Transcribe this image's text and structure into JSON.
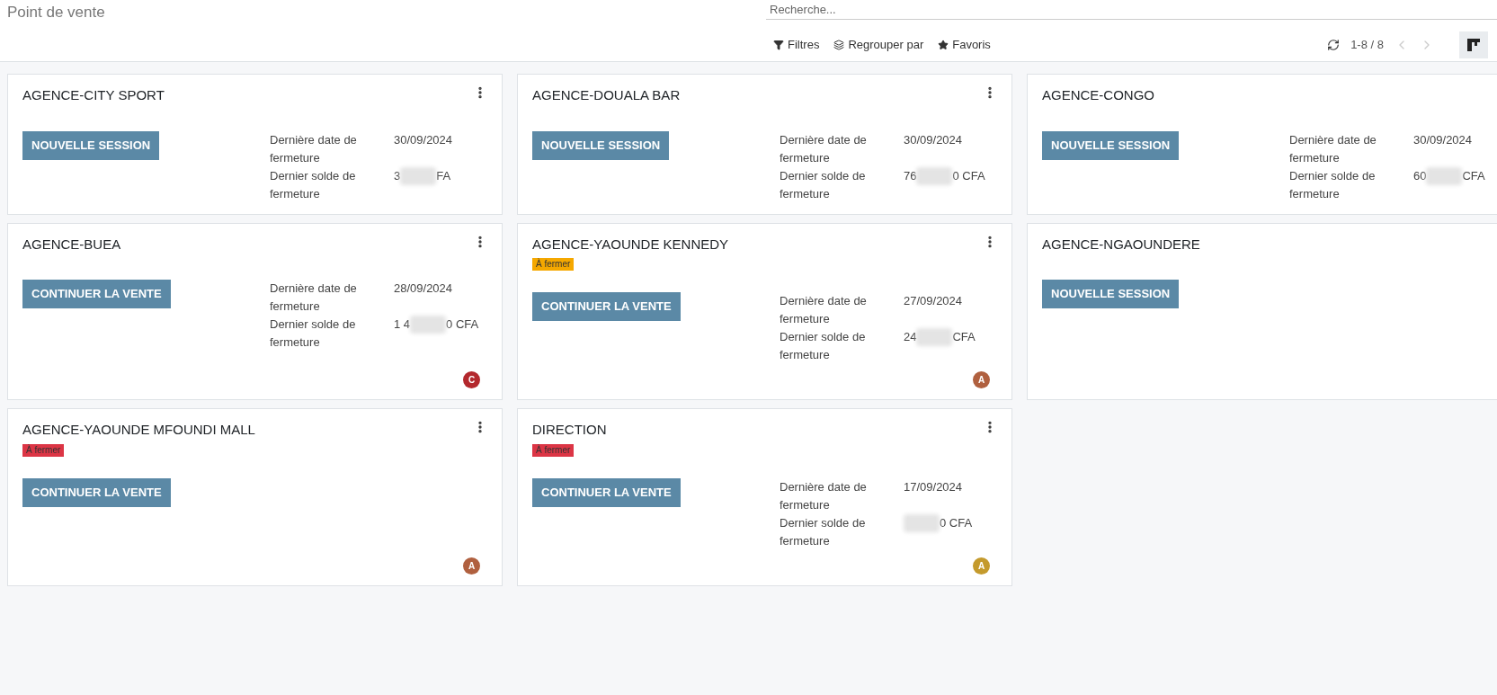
{
  "page_title": "Point de vente",
  "search": {
    "placeholder": "Recherche..."
  },
  "toolbar": [
    {
      "kind": "filter",
      "label": "Filtres"
    },
    {
      "kind": "group",
      "label": "Regrouper par"
    },
    {
      "kind": "favorite",
      "label": "Favoris"
    }
  ],
  "pager": {
    "range": "1-8 / 8",
    "previous_disabled": true,
    "next_disabled": true
  },
  "view_switcher": {
    "selected": true
  },
  "cards": [
    {
      "name": "AGENCE-CITY SPORT",
      "menu": true,
      "action": "NOUVELLE SESSION",
      "details": [
        {
          "label": "Dernière date de fermeture",
          "value": "30/09/2024"
        },
        {
          "label": "Dernier solde de fermeture",
          "value_start": "3",
          "value_end": "FA",
          "blurred": true
        }
      ]
    },
    {
      "name": "AGENCE-DOUALA BAR",
      "menu": true,
      "action": "NOUVELLE SESSION",
      "details": [
        {
          "label": "Dernière date de fermeture",
          "value": "30/09/2024"
        },
        {
          "label": "Dernier solde de fermeture",
          "value_start": "76",
          "value_end": "0 CFA",
          "blurred": true
        }
      ]
    },
    {
      "name": "AGENCE-CONGO",
      "action": "NOUVELLE SESSION",
      "details": [
        {
          "label": "Dernière date de fermeture",
          "value": "30/09/2024"
        },
        {
          "label": "Dernier solde de fermeture",
          "value_start": "60",
          "value_end": "CFA",
          "blurred": true
        }
      ]
    },
    {
      "name": "AGENCE-BUEA",
      "menu": true,
      "action": "CONTINUER LA VENTE",
      "details": [
        {
          "label": "Dernière date de fermeture",
          "value": "28/09/2024"
        },
        {
          "label": "Dernier solde de fermeture",
          "value_start": "1 4",
          "value_end": "0 CFA",
          "blurred": true
        }
      ],
      "avatar": {
        "letter": "C",
        "color": "#b3282d"
      }
    },
    {
      "name": "AGENCE-YAOUNDE KENNEDY",
      "menu": true,
      "tag": {
        "label": "À fermer",
        "color": "#f5a800"
      },
      "action": "CONTINUER LA VENTE",
      "details": [
        {
          "label": "Dernière date de fermeture",
          "value": "27/09/2024"
        },
        {
          "label": "Dernier solde de fermeture",
          "value_start": "24",
          "value_end": "CFA",
          "blurred": true
        }
      ],
      "avatar": {
        "letter": "A",
        "color": "#b0603f"
      }
    },
    {
      "name": "AGENCE-NGAOUNDERE",
      "action": "NOUVELLE SESSION"
    },
    {
      "name": "AGENCE-YAOUNDE MFOUNDI MALL",
      "menu": true,
      "tag": {
        "label": "À fermer",
        "color": "#dc3545"
      },
      "action": "CONTINUER LA VENTE",
      "avatar": {
        "letter": "A",
        "color": "#b0603f"
      }
    },
    {
      "name": "DIRECTION",
      "menu": true,
      "tag": {
        "label": "À fermer",
        "color": "#dc3545"
      },
      "action": "CONTINUER LA VENTE",
      "details": [
        {
          "label": "Dernière date de fermeture",
          "value": "17/09/2024"
        },
        {
          "label": "Dernier solde de fermeture",
          "value_end": "0 CFA",
          "blurred": true
        }
      ],
      "avatar": {
        "letter": "A",
        "color": "#c49a2c"
      }
    }
  ]
}
